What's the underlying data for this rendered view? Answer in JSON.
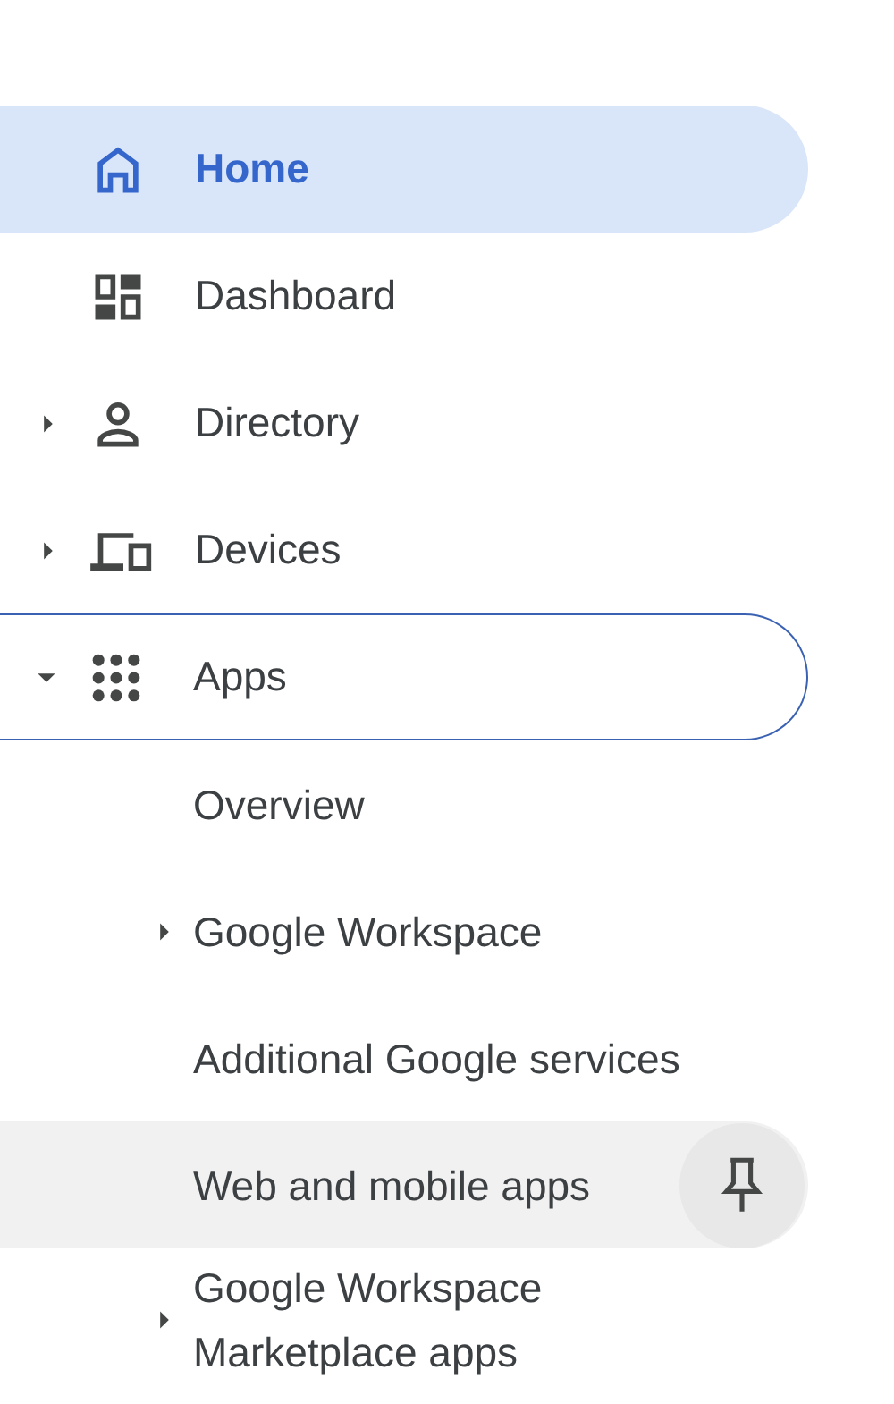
{
  "nav": {
    "items": [
      {
        "label": "Home",
        "selected": true,
        "focused": false
      },
      {
        "label": "Dashboard",
        "selected": false,
        "focused": false
      },
      {
        "label": "Directory",
        "selected": false,
        "focused": false,
        "expanded": false
      },
      {
        "label": "Devices",
        "selected": false,
        "focused": false,
        "expanded": false
      },
      {
        "label": "Apps",
        "selected": false,
        "focused": true,
        "expanded": true,
        "children": [
          {
            "label": "Overview",
            "hovered": false
          },
          {
            "label": "Google Workspace",
            "hovered": false,
            "expanded": false
          },
          {
            "label": "Additional Google services",
            "hovered": false
          },
          {
            "label": "Web and mobile apps",
            "hovered": true
          },
          {
            "label": "Google Workspace Marketplace apps",
            "hovered": false,
            "expanded": false
          }
        ]
      }
    ]
  }
}
